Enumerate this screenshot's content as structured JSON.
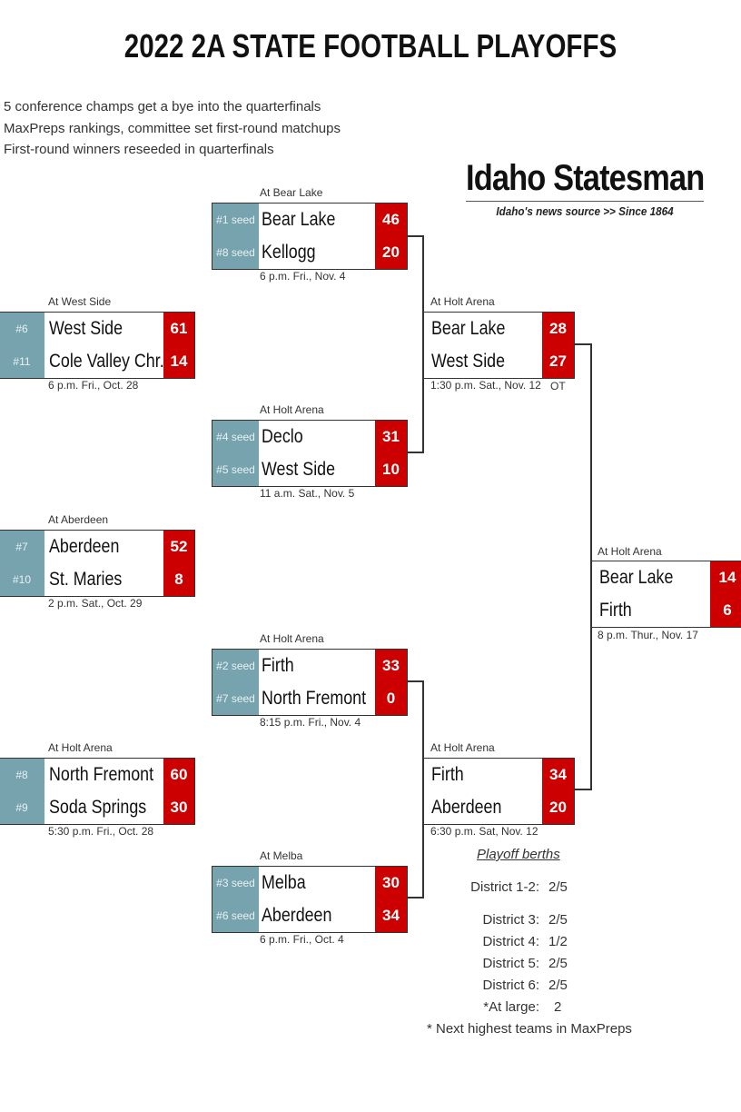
{
  "title": "2022 2A STATE FOOTBALL PLAYOFFS",
  "notes": [
    "5 conference champs get a bye into the quarterfinals",
    "MaxPreps rankings, committee set first-round matchups",
    "First-round winners reseeded in quarterfinals"
  ],
  "brand": {
    "name": "Idaho Statesman",
    "tagline": "Idaho's news source >> Since 1864"
  },
  "colors": {
    "seed_bg": "#77a3ae",
    "score_bg": "#cc0000",
    "border": "#333333"
  },
  "first_round": [
    {
      "venue": "At West Side",
      "teams": [
        {
          "seed": "#6",
          "name": "West Side",
          "score": "61"
        },
        {
          "seed": "#11",
          "name": "Cole Valley Chr.",
          "score": "14"
        }
      ],
      "time": "6 p.m. Fri., Oct. 28"
    },
    {
      "venue": "At Aberdeen",
      "teams": [
        {
          "seed": "#7",
          "name": "Aberdeen",
          "score": "52"
        },
        {
          "seed": "#10",
          "name": "St. Maries",
          "score": "8"
        }
      ],
      "time": "2 p.m. Sat., Oct. 29"
    },
    {
      "venue": "At Holt Arena",
      "teams": [
        {
          "seed": "#8",
          "name": "North Fremont",
          "score": "60"
        },
        {
          "seed": "#9",
          "name": "Soda Springs",
          "score": "30"
        }
      ],
      "time": "5:30 p.m. Fri., Oct. 28"
    }
  ],
  "quarterfinals": [
    {
      "venue": "At Bear Lake",
      "teams": [
        {
          "seed": "#1 seed",
          "name": "Bear Lake",
          "score": "46"
        },
        {
          "seed": "#8 seed",
          "name": "Kellogg",
          "score": "20"
        }
      ],
      "time": "6 p.m. Fri., Nov. 4"
    },
    {
      "venue": "At Holt Arena",
      "teams": [
        {
          "seed": "#4 seed",
          "name": "Declo",
          "score": "31"
        },
        {
          "seed": "#5 seed",
          "name": "West Side",
          "score": "10"
        }
      ],
      "time": "11 a.m. Sat., Nov. 5"
    },
    {
      "venue": "At Holt Arena",
      "teams": [
        {
          "seed": "#2 seed",
          "name": "Firth",
          "score": "33"
        },
        {
          "seed": "#7 seed",
          "name": "North Fremont",
          "score": "0"
        }
      ],
      "time": "8:15 p.m. Fri., Nov. 4"
    },
    {
      "venue": "At Melba",
      "teams": [
        {
          "seed": "#3 seed",
          "name": "Melba",
          "score": "30"
        },
        {
          "seed": "#6 seed",
          "name": "Aberdeen",
          "score": "34"
        }
      ],
      "time": "6 p.m. Fri., Oct. 4"
    }
  ],
  "semifinals": [
    {
      "venue": "At Holt Arena",
      "teams": [
        {
          "name": "Bear Lake",
          "score": "28"
        },
        {
          "name": "West Side",
          "score": "27"
        }
      ],
      "time": "1:30 p.m. Sat., Nov. 12",
      "note": "OT"
    },
    {
      "venue": "At Holt Arena",
      "teams": [
        {
          "name": "Firth",
          "score": "34"
        },
        {
          "name": "Aberdeen",
          "score": "20"
        }
      ],
      "time": "6:30 p.m. Sat, Nov. 12"
    }
  ],
  "final": {
    "venue": "At Holt Arena",
    "teams": [
      {
        "name": "Bear Lake",
        "score": "14"
      },
      {
        "name": "Firth",
        "score": "6"
      }
    ],
    "time": "8 p.m. Thur., Nov. 17"
  },
  "berths": {
    "title": "Playoff berths",
    "rows": [
      {
        "label": "District 1-2:",
        "value": "2/5"
      },
      {
        "label": "District 3:",
        "value": "2/5"
      },
      {
        "label": "District 4:",
        "value": "1/2"
      },
      {
        "label": "District 5:",
        "value": "2/5"
      },
      {
        "label": "District 6:",
        "value": "2/5"
      },
      {
        "label": "*At large:",
        "value": "2"
      }
    ],
    "footnote": "* Next highest teams in MaxPreps"
  }
}
